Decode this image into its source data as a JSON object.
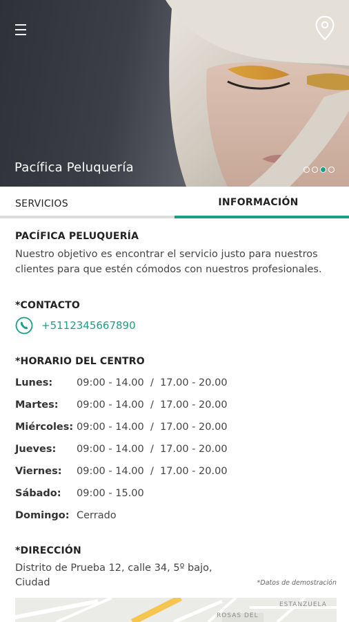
{
  "hero": {
    "title": "Pacífica Peluquería",
    "slides_total": 4,
    "slide_active": 3,
    "icons": {
      "menu": "hamburger-menu-icon",
      "location": "map-pin-icon"
    }
  },
  "tabs": [
    {
      "label": "SERVICIOS",
      "active": false
    },
    {
      "label": "INFORMACIÓN",
      "active": true
    }
  ],
  "about": {
    "title": "PACÍFICA PELUQUERÍA",
    "text": "Nuestro objetivo es encontrar el servicio justo para nuestros clientes para que estén cómodos con nuestros profesionales."
  },
  "contact": {
    "title": "*CONTACTO",
    "phone": "+5112345667890",
    "icon": "phone-icon"
  },
  "schedule": {
    "title": "*HORARIO DEL CENTRO",
    "rows": [
      {
        "day": "Lunes:",
        "hours": "09:00 - 14.00  /  17.00 - 20.00"
      },
      {
        "day": "Martes:",
        "hours": "09:00 - 14.00  /  17.00 - 20.00"
      },
      {
        "day": "Miércoles:",
        "hours": "09:00 - 14.00  /  17.00 - 20.00"
      },
      {
        "day": "Jueves:",
        "hours": "09:00 - 14.00  /  17.00 - 20.00"
      },
      {
        "day": "Viernes:",
        "hours": "09:00 - 14.00  /  17.00 - 20.00"
      },
      {
        "day": "Sábado:",
        "hours": "09:00 - 15.00"
      },
      {
        "day": "Domingo:",
        "hours": "Cerrado"
      }
    ]
  },
  "address": {
    "title": "*DIRECCIÓN",
    "text": "Distrito de Prueba 12, calle 34, 5º bajo, Ciudad",
    "demo_note": "*Datos de demostración",
    "map_labels": [
      "ESTANZUELA",
      "ROSAS DEL"
    ]
  },
  "colors": {
    "accent": "#179f87",
    "hero_dark": "#2f3139"
  }
}
